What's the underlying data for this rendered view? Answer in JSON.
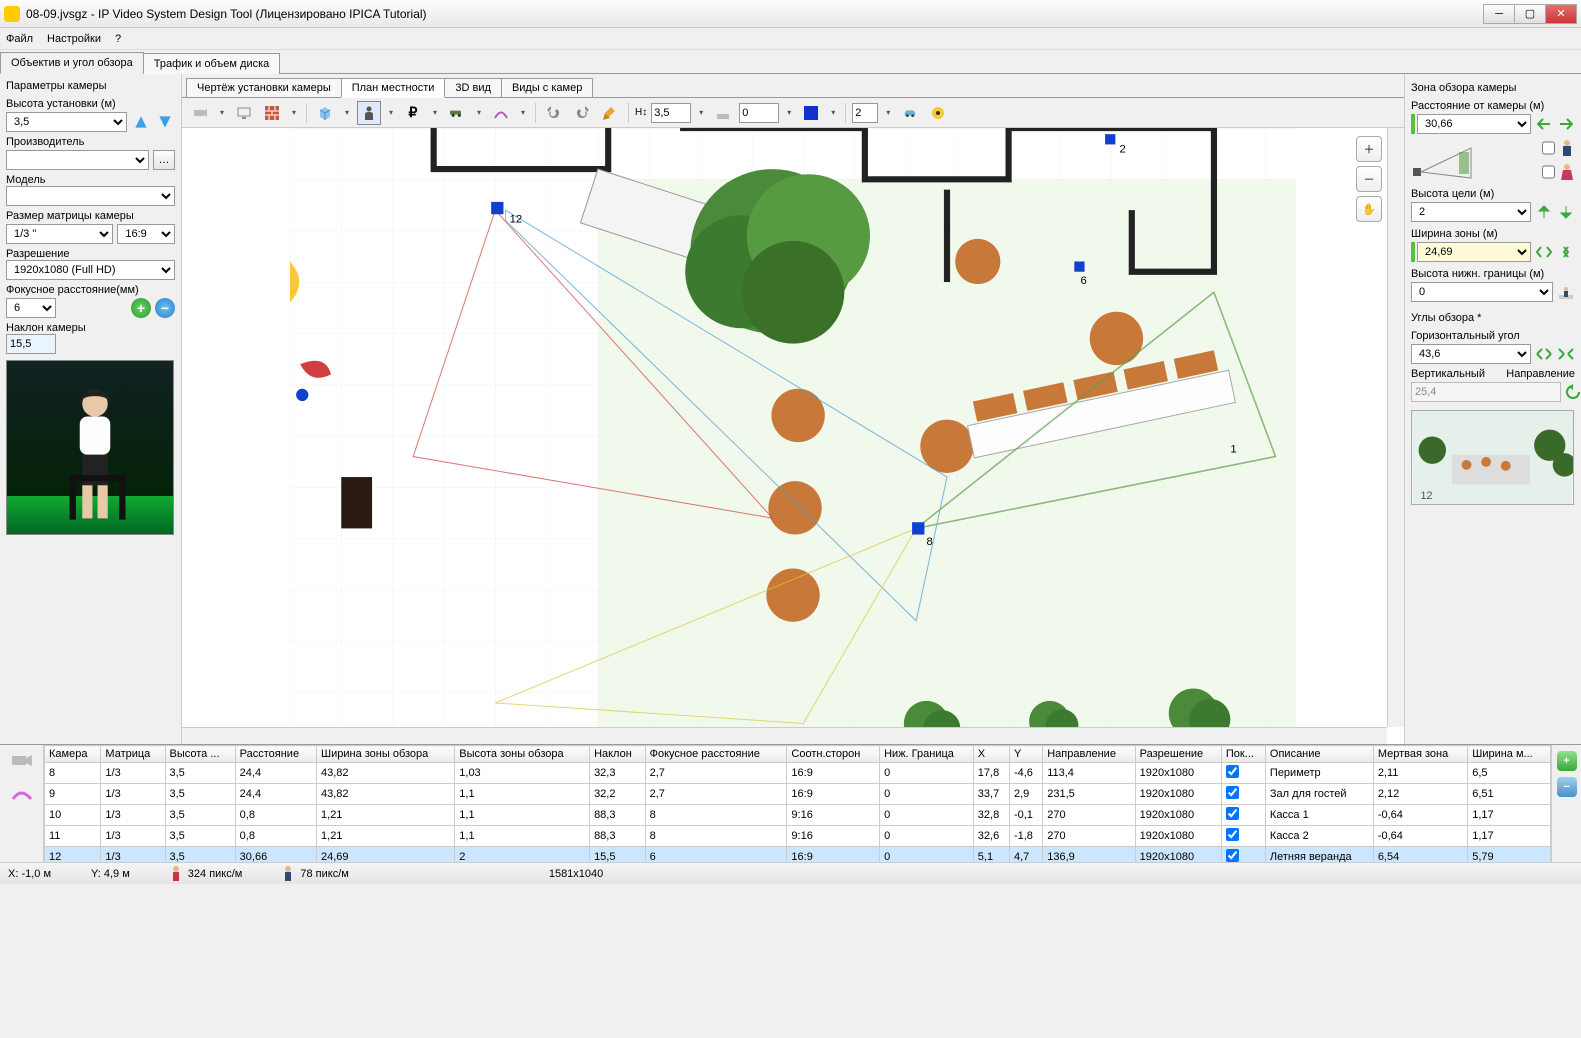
{
  "window": {
    "title": "08-09.jvsgz - IP Video System Design Tool (Лицензировано  IPICA Tutorial)"
  },
  "menu": {
    "items": [
      "Файл",
      "Настройки",
      "?"
    ]
  },
  "mainTabs": [
    "Объектив и угол обзора",
    "Трафик и объем диска"
  ],
  "leftPanel": {
    "title": "Параметры камеры",
    "heightLabel": "Высота установки (м)",
    "heightValue": "3,5",
    "manufacturerLabel": "Производитель",
    "manufacturerValue": "",
    "modelLabel": "Модель",
    "modelValue": "",
    "sensorLabel": "Размер матрицы камеры",
    "sensorValue": "1/3 \"",
    "aspectValue": "16:9",
    "resolutionLabel": "Разрешение",
    "resolutionValue": "1920x1080 (Full HD)",
    "focalLabel": "Фокусное расстояние(мм)",
    "focalValue": "6",
    "tiltLabel": "Наклон камеры",
    "tiltValue": "15,5"
  },
  "centerTabs": [
    "Чертёж установки камеры",
    "План местности",
    "3D вид",
    "Виды с камер"
  ],
  "toolbar": {
    "heightLabel": "H↕",
    "heightVal": "3,5",
    "widthVal": "0",
    "numVal": "2"
  },
  "rightPanel": {
    "title": "Зона обзора камеры",
    "distLabel": "Расстояние от камеры (м)",
    "distVal": "30,66",
    "targetHLabel": "Высота цели (м)",
    "targetHVal": "2",
    "zoneWLabel": "Ширина зоны (м)",
    "zoneWVal": "24,69",
    "lowerHLabel": "Высота нижн. границы (м)",
    "lowerHVal": "0",
    "anglesTitle": "Углы обзора *",
    "hAngleLabel": "Горизонтальный угол",
    "hAngleVal": "43,6",
    "vAngleLabel": "Вертикальный",
    "dirLabel": "Направление",
    "vAngleVal": "25,4"
  },
  "table": {
    "headers": [
      "Камера",
      "Матрица",
      "Высота ...",
      "Расстояние",
      "Ширина зоны обзора",
      "Высота зоны обзора",
      "Наклон",
      "Фокусное расстояние",
      "Соотн.сторон",
      "Ниж. Граница",
      "X",
      "Y",
      "Направление",
      "Разрешение",
      "Пок...",
      "Описание",
      "Мертвая зона",
      "Ширина м..."
    ],
    "rows": [
      [
        "8",
        "1/3",
        "3,5",
        "24,4",
        "43,82",
        "1,03",
        "32,3",
        "2,7",
        "16:9",
        "0",
        "17,8",
        "-4,6",
        "113,4",
        "1920x1080",
        "✔",
        "Периметр",
        "2,11",
        "6,5"
      ],
      [
        "9",
        "1/3",
        "3,5",
        "24,4",
        "43,82",
        "1,1",
        "32,2",
        "2,7",
        "16:9",
        "0",
        "33,7",
        "2,9",
        "231,5",
        "1920x1080",
        "✔",
        "Зал для гостей",
        "2,12",
        "6,51"
      ],
      [
        "10",
        "1/3",
        "3,5",
        "0,8",
        "1,21",
        "1,1",
        "88,3",
        "8",
        "9:16",
        "0",
        "32,8",
        "-0,1",
        "270",
        "1920x1080",
        "✔",
        "Касса  1",
        "-0,64",
        "1,17"
      ],
      [
        "11",
        "1/3",
        "3,5",
        "0,8",
        "1,21",
        "1,1",
        "88,3",
        "8",
        "9:16",
        "0",
        "32,6",
        "-1,8",
        "270",
        "1920x1080",
        "✔",
        "Касса 2",
        "-0,64",
        "1,17"
      ],
      [
        "12",
        "1/3",
        "3,5",
        "30,66",
        "24,69",
        "2",
        "15,5",
        "6",
        "16:9",
        "0",
        "5,1",
        "4,7",
        "136,9",
        "1920x1080",
        "✔",
        "Летняя веранда",
        "6,54",
        "5,79"
      ]
    ],
    "selectedRow": 4
  },
  "status": {
    "x": "X: -1,0 м",
    "y": "Y: 4,9 м",
    "px1": "324 пикс/м",
    "px2": "78 пикс/м",
    "dims": "1581x1040"
  },
  "canvas": {
    "markers": [
      "12",
      "8",
      "2",
      "6",
      "1"
    ]
  }
}
